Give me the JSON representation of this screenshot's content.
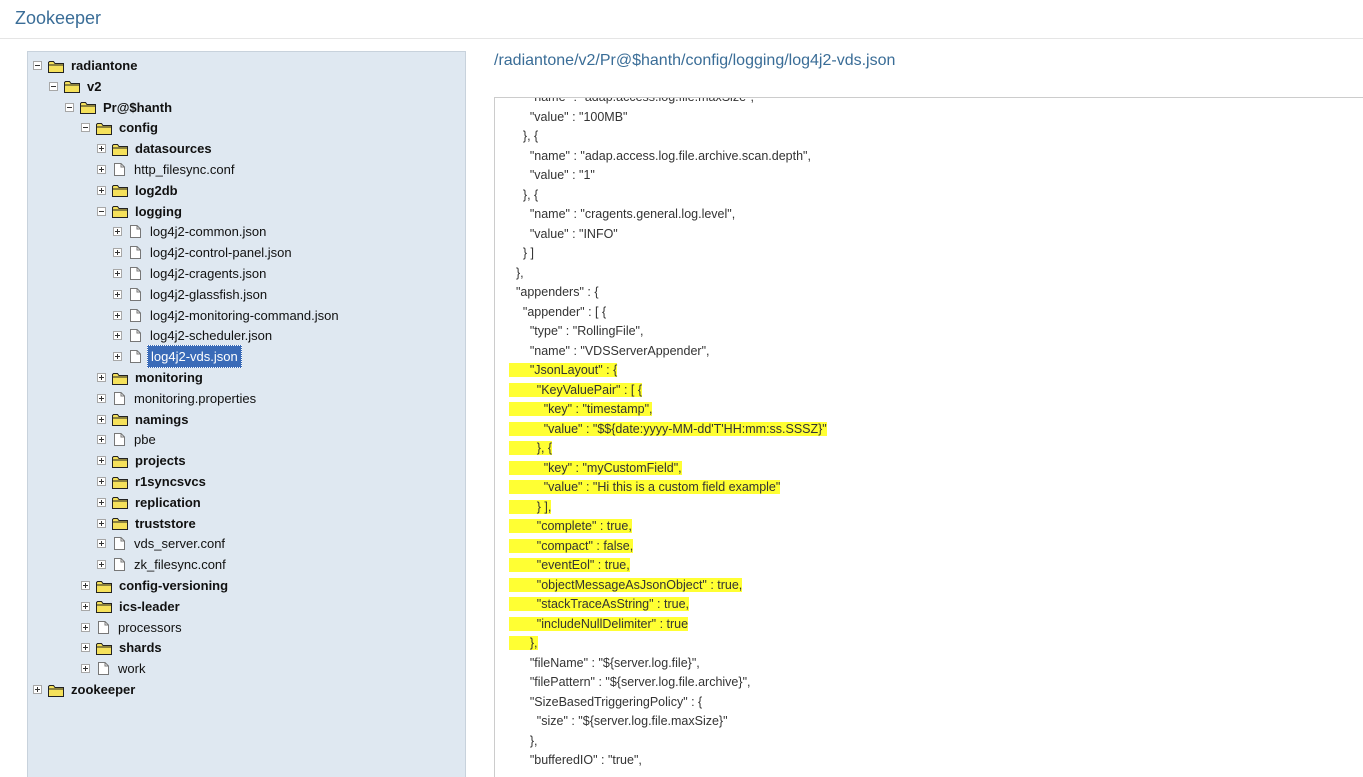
{
  "app": {
    "title": "Zookeeper"
  },
  "tree": {
    "nodes": [
      {
        "label": "radiantone",
        "type": "folder",
        "depth": 0,
        "state": "expanded"
      },
      {
        "label": "v2",
        "type": "folder",
        "depth": 1,
        "state": "expanded"
      },
      {
        "label": "Pr@$hanth",
        "type": "folder",
        "depth": 2,
        "state": "expanded"
      },
      {
        "label": "config",
        "type": "folder",
        "depth": 3,
        "state": "expanded"
      },
      {
        "label": "datasources",
        "type": "folder",
        "depth": 4,
        "state": "collapsed"
      },
      {
        "label": "http_filesync.conf",
        "type": "file",
        "depth": 4,
        "state": "collapsed"
      },
      {
        "label": "log2db",
        "type": "folder",
        "depth": 4,
        "state": "collapsed"
      },
      {
        "label": "logging",
        "type": "folder",
        "depth": 4,
        "state": "expanded"
      },
      {
        "label": "log4j2-common.json",
        "type": "file",
        "depth": 5,
        "state": "collapsed"
      },
      {
        "label": "log4j2-control-panel.json",
        "type": "file",
        "depth": 5,
        "state": "collapsed"
      },
      {
        "label": "log4j2-cragents.json",
        "type": "file",
        "depth": 5,
        "state": "collapsed"
      },
      {
        "label": "log4j2-glassfish.json",
        "type": "file",
        "depth": 5,
        "state": "collapsed"
      },
      {
        "label": "log4j2-monitoring-command.json",
        "type": "file",
        "depth": 5,
        "state": "collapsed"
      },
      {
        "label": "log4j2-scheduler.json",
        "type": "file",
        "depth": 5,
        "state": "collapsed"
      },
      {
        "label": "log4j2-vds.json",
        "type": "file",
        "depth": 5,
        "state": "collapsed",
        "selected": true
      },
      {
        "label": "monitoring",
        "type": "folder",
        "depth": 4,
        "state": "collapsed"
      },
      {
        "label": "monitoring.properties",
        "type": "file",
        "depth": 4,
        "state": "collapsed"
      },
      {
        "label": "namings",
        "type": "folder",
        "depth": 4,
        "state": "collapsed"
      },
      {
        "label": "pbe",
        "type": "file",
        "depth": 4,
        "state": "collapsed"
      },
      {
        "label": "projects",
        "type": "folder",
        "depth": 4,
        "state": "collapsed"
      },
      {
        "label": "r1syncsvcs",
        "type": "folder",
        "depth": 4,
        "state": "collapsed"
      },
      {
        "label": "replication",
        "type": "folder",
        "depth": 4,
        "state": "collapsed"
      },
      {
        "label": "truststore",
        "type": "folder",
        "depth": 4,
        "state": "collapsed"
      },
      {
        "label": "vds_server.conf",
        "type": "file",
        "depth": 4,
        "state": "collapsed"
      },
      {
        "label": "zk_filesync.conf",
        "type": "file",
        "depth": 4,
        "state": "collapsed"
      },
      {
        "label": "config-versioning",
        "type": "folder",
        "depth": 3,
        "state": "collapsed"
      },
      {
        "label": "ics-leader",
        "type": "folder",
        "depth": 3,
        "state": "collapsed"
      },
      {
        "label": "processors",
        "type": "file",
        "depth": 3,
        "state": "collapsed"
      },
      {
        "label": "shards",
        "type": "folder",
        "depth": 3,
        "state": "collapsed"
      },
      {
        "label": "work",
        "type": "file",
        "depth": 3,
        "state": "collapsed"
      },
      {
        "label": "zookeeper",
        "type": "folder",
        "depth": 0,
        "state": "collapsed"
      }
    ]
  },
  "content": {
    "path": "/radiantone/v2/Pr@$hanth/config/logging/log4j2-vds.json",
    "lines": [
      {
        "text": "      \"name\" : \"adap.access.log.file.maxSize\",",
        "hl": false
      },
      {
        "text": "      \"value\" : \"100MB\"",
        "hl": false
      },
      {
        "text": "    }, {",
        "hl": false
      },
      {
        "text": "      \"name\" : \"adap.access.log.file.archive.scan.depth\",",
        "hl": false
      },
      {
        "text": "      \"value\" : \"1\"",
        "hl": false
      },
      {
        "text": "    }, {",
        "hl": false
      },
      {
        "text": "      \"name\" : \"cragents.general.log.level\",",
        "hl": false
      },
      {
        "text": "      \"value\" : \"INFO\"",
        "hl": false
      },
      {
        "text": "    } ]",
        "hl": false
      },
      {
        "text": "  },",
        "hl": false
      },
      {
        "text": "  \"appenders\" : {",
        "hl": false
      },
      {
        "text": "    \"appender\" : [ {",
        "hl": false
      },
      {
        "text": "      \"type\" : \"RollingFile\",",
        "hl": false
      },
      {
        "text": "      \"name\" : \"VDSServerAppender\",",
        "hl": false
      },
      {
        "text": "      \"JsonLayout\" : {",
        "hl": true
      },
      {
        "text": "        \"KeyValuePair\" : [ {",
        "hl": true
      },
      {
        "text": "          \"key\" : \"timestamp\",",
        "hl": true
      },
      {
        "text": "          \"value\" : \"$${date:yyyy-MM-dd'T'HH:mm:ss.SSSZ}\"",
        "hl": true
      },
      {
        "text": "        }, {",
        "hl": true
      },
      {
        "text": "          \"key\" : \"myCustomField\",",
        "hl": true
      },
      {
        "text": "          \"value\" : \"Hi this is a custom field example\"",
        "hl": true
      },
      {
        "text": "        } ],",
        "hl": true
      },
      {
        "text": "        \"complete\" : true,",
        "hl": true
      },
      {
        "text": "        \"compact\" : false,",
        "hl": true
      },
      {
        "text": "        \"eventEol\" : true,",
        "hl": true
      },
      {
        "text": "        \"objectMessageAsJsonObject\" : true,",
        "hl": true
      },
      {
        "text": "        \"stackTraceAsString\" : true,",
        "hl": true
      },
      {
        "text": "        \"includeNullDelimiter\" : true",
        "hl": true
      },
      {
        "text": "      },",
        "hl": true
      },
      {
        "text": "      \"fileName\" : \"${server.log.file}\",",
        "hl": false
      },
      {
        "text": "      \"filePattern\" : \"${server.log.file.archive}\",",
        "hl": false
      },
      {
        "text": "      \"SizeBasedTriggeringPolicy\" : {",
        "hl": false
      },
      {
        "text": "        \"size\" : \"${server.log.file.maxSize}\"",
        "hl": false
      },
      {
        "text": "      },",
        "hl": false
      },
      {
        "text": "      \"bufferedIO\" : \"true\",",
        "hl": false
      }
    ]
  },
  "colors": {
    "accent": "#3a6d97",
    "tree_bg": "#dfe8f1",
    "selection": "#3a6bb8",
    "highlight": "#ffff33",
    "folder": "#f5e15b"
  }
}
